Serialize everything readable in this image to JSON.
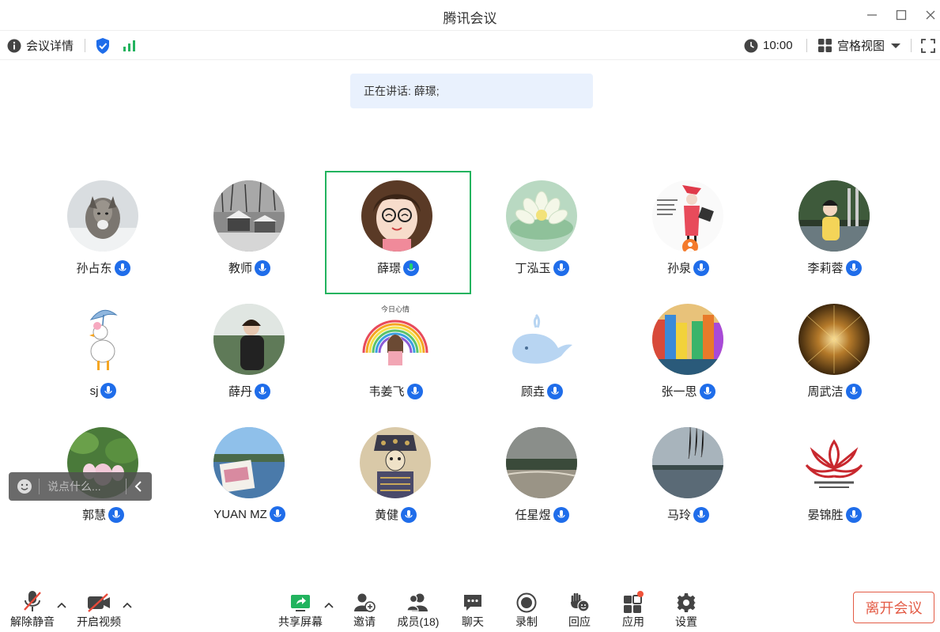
{
  "window": {
    "title": "腾讯会议"
  },
  "infobar": {
    "details_label": "会议详情",
    "time": "10:00",
    "view_label": "宫格视图"
  },
  "speaking": {
    "text": "正在讲话: 薛璟;"
  },
  "participants": [
    {
      "name": "孙占东",
      "avatar": "wolf-photo"
    },
    {
      "name": "教师",
      "avatar": "snowy-village-photo"
    },
    {
      "name": "薛璟",
      "avatar": "cartoon-girl-glasses",
      "active": true
    },
    {
      "name": "丁泓玉",
      "avatar": "lotus-photo"
    },
    {
      "name": "孙泉",
      "avatar": "fashion-illustration"
    },
    {
      "name": "李莉蓉",
      "avatar": "child-photo"
    },
    {
      "name": "sj",
      "avatar": "duck-umbrella"
    },
    {
      "name": "薛丹",
      "avatar": "man-outdoors-photo"
    },
    {
      "name": "韦姜飞",
      "avatar": "rainbow-girl",
      "avatar_caption": "今日心情"
    },
    {
      "name": "顾垚",
      "avatar": "blue-whale"
    },
    {
      "name": "张一思",
      "avatar": "colorful-houses-photo"
    },
    {
      "name": "周武洁",
      "avatar": "golden-fireworks"
    },
    {
      "name": "郭慧",
      "avatar": "lotus-pond-photo"
    },
    {
      "name": "YUAN MZ",
      "avatar": "lake-town-photo"
    },
    {
      "name": "黄健",
      "avatar": "ethnic-pattern"
    },
    {
      "name": "任星煜",
      "avatar": "beach-photo"
    },
    {
      "name": "马玲",
      "avatar": "lake-dusk-photo"
    },
    {
      "name": "晏锦胜",
      "avatar": "lotus-logo"
    }
  ],
  "chat": {
    "placeholder": "说点什么..."
  },
  "toolbar": {
    "unmute": "解除静音",
    "start_video": "开启视频",
    "share_screen": "共享屏幕",
    "invite": "邀请",
    "members": "成员(18)",
    "chat": "聊天",
    "record": "录制",
    "react": "回应",
    "apps": "应用",
    "settings": "设置",
    "leave": "离开会议"
  },
  "colors": {
    "accent": "#1f6dea",
    "active_border": "#22b35e",
    "leave": "#e35b45",
    "signal": "#22b35e"
  }
}
